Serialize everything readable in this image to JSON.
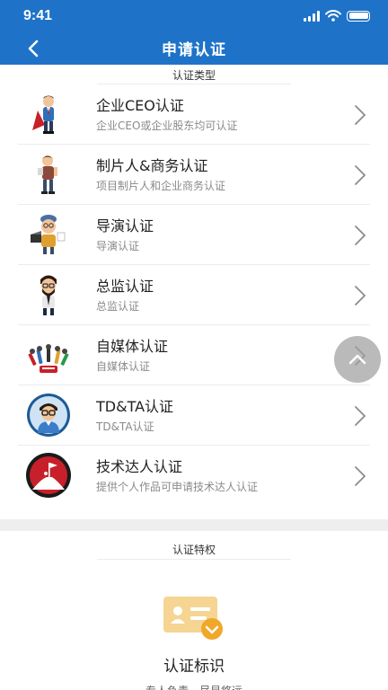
{
  "status": {
    "time": "9:41"
  },
  "header": {
    "title": "申请认证",
    "back_icon": "chevron-left-icon",
    "color": "#1e73c8"
  },
  "types_section": {
    "label": "认证类型"
  },
  "items": [
    {
      "title": "企业CEO认证",
      "desc": "企业CEO或企业股东均可认证",
      "icon": "ceo-superhero-avatar"
    },
    {
      "title": "制片人&商务认证",
      "desc": "项目制片人和企业商务认证",
      "icon": "producer-avatar"
    },
    {
      "title": "导演认证",
      "desc": "导演认证",
      "icon": "director-avatar"
    },
    {
      "title": "总监认证",
      "desc": "总监认证",
      "icon": "supervisor-avatar"
    },
    {
      "title": "自媒体认证",
      "desc": "自媒体认证",
      "icon": "media-microphones-avatar"
    },
    {
      "title": "TD&TA认证",
      "desc": "TD&TA认证",
      "icon": "td-ta-avatar"
    },
    {
      "title": "技术达人认证",
      "desc": "提供个人作品可申请技术达人认证",
      "icon": "climber-flag-avatar"
    }
  ],
  "features_section": {
    "label": "认证特权"
  },
  "feature": {
    "title": "认证标识",
    "subtitle": "专人负责，尽显悠远",
    "icon": "id-card-badge-icon"
  },
  "floating_button": {
    "icon": "chevron-up-icon"
  }
}
